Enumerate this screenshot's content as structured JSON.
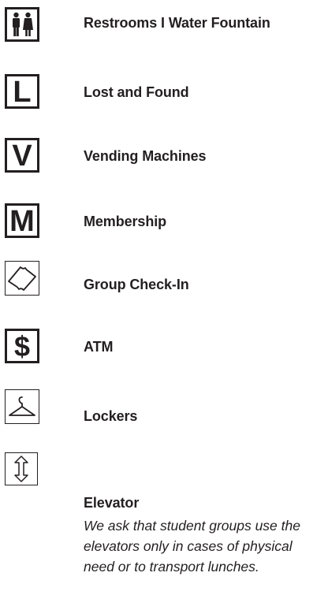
{
  "amenities": [
    {
      "label": "Restrooms I Water Fountain",
      "icon": "restroom-icon"
    },
    {
      "label": "Lost and Found",
      "icon": "letter-l-icon",
      "letter": "L"
    },
    {
      "label": "Vending Machines",
      "icon": "letter-v-icon",
      "letter": "V"
    },
    {
      "label": "Membership",
      "icon": "letter-m-icon",
      "letter": "M"
    },
    {
      "label": "Group Check-In",
      "icon": "ticket-icon"
    },
    {
      "label": "ATM",
      "icon": "dollar-icon",
      "letter": "$"
    },
    {
      "label": "Lockers",
      "icon": "hanger-icon"
    },
    {
      "label": "Elevator",
      "icon": "elevator-arrows-icon"
    }
  ],
  "elevator_note": "We ask that student groups use the elevators only in cases of physical need or to transport lunches.",
  "colors": {
    "ink": "#231f20",
    "background": "#ffffff"
  }
}
